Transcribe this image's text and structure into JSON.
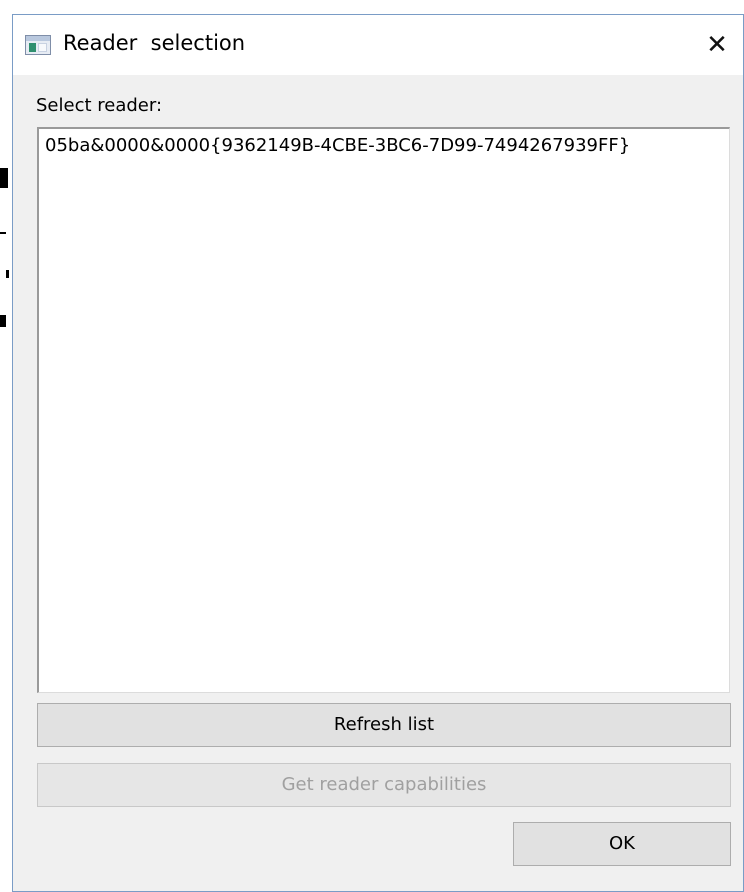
{
  "window": {
    "title": "Reader  selection",
    "close_symbol": "✕"
  },
  "content": {
    "select_label": "Select reader:",
    "readers": [
      "05ba&0000&0000{9362149B-4CBE-3BC6-7D99-7494267939FF}"
    ]
  },
  "buttons": {
    "refresh_label": "Refresh list",
    "capabilities_label": "Get reader capabilities",
    "ok_label": "OK"
  },
  "colors": {
    "dialog_bg": "#f0f0f0",
    "disabled_text": "#a0a0a0"
  },
  "icons": {
    "app": "app-window-icon",
    "close": "close-icon"
  }
}
